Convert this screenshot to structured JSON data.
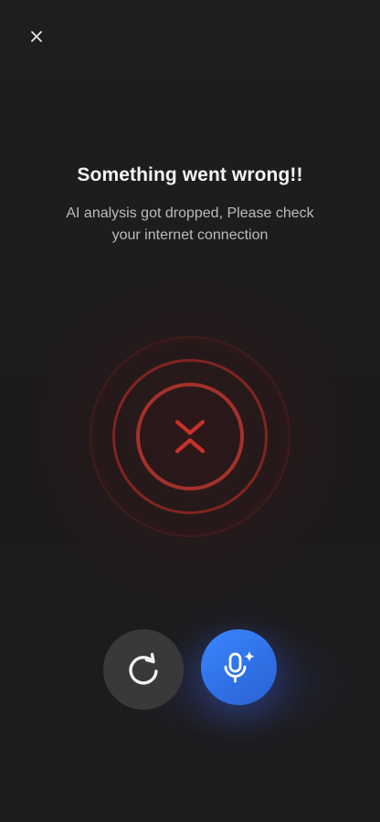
{
  "error": {
    "title": "Something went wrong!!",
    "message": "AI analysis got dropped, Please check your internet connection"
  },
  "icons": {
    "close": "close-icon",
    "error": "collapse-x-icon",
    "retry": "retry-icon",
    "mic": "mic-sparkle-icon"
  },
  "colors": {
    "background": "#1d1b1d",
    "error_red": "#c8312a",
    "ring_red": "#a4312b",
    "retry_bg": "#3a3839",
    "mic_blue": "#3b86ff"
  }
}
